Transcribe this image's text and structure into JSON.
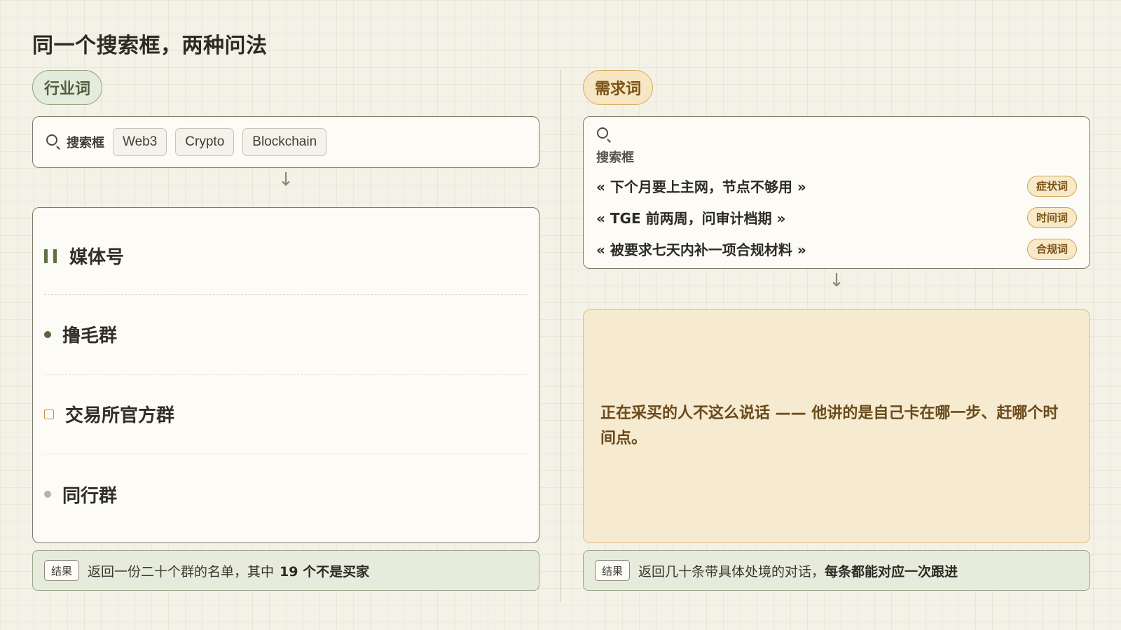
{
  "page": {
    "title": "同一个搜索框，两种问法"
  },
  "left": {
    "pill": "行业词",
    "search_label": "搜索框",
    "chips": [
      "Web3",
      "Crypto",
      "Blockchain"
    ],
    "arrow": "↓",
    "results": [
      "媒体号",
      "撸毛群",
      "交易所官方群",
      "同行群"
    ],
    "bottom": {
      "tag": "结果",
      "text": "返回一份二十个群的名单，其中",
      "highlight": "19 个不是买家"
    }
  },
  "right": {
    "pill": "需求词",
    "search_label": "搜索框",
    "queries": [
      {
        "text": "« 下个月要上主网，节点不够用 »",
        "tag": "症状词"
      },
      {
        "text": "« TGE 前两周，问审计档期 »",
        "tag": "时间词"
      },
      {
        "text": "« 被要求七天内补一项合规材料 »",
        "tag": "合规词"
      }
    ],
    "arrow": "↓",
    "insight": "正在采买的人不这么说话 —— 他讲的是自己卡在哪一步、赶哪个时间点。",
    "bottom": {
      "tag": "结果",
      "text": "返回几十条带具体处境的对话，",
      "highlight": "每条都能对应一次跟进"
    }
  }
}
